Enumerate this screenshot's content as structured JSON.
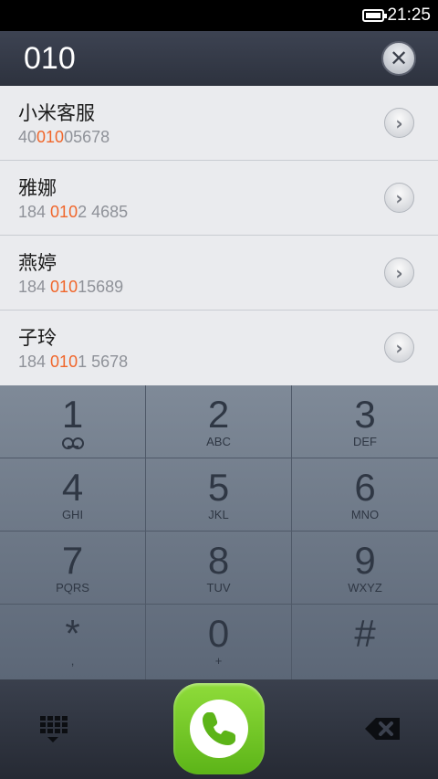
{
  "status_bar": {
    "time": "21:25"
  },
  "dialer": {
    "input": "010"
  },
  "contacts": [
    {
      "name": "小米客服",
      "num_pre": "40",
      "num_hl": "010",
      "num_post": "05678"
    },
    {
      "name": "雅娜",
      "num_pre": "184 ",
      "num_hl": "010",
      "num_post": "2 4685"
    },
    {
      "name": "燕婷",
      "num_pre": "184 ",
      "num_hl": "010",
      "num_post": "15689"
    },
    {
      "name": "子玲",
      "num_pre": "184 ",
      "num_hl": "010",
      "num_post": "1 5678"
    }
  ],
  "keys": [
    {
      "digit": "1",
      "letters": ""
    },
    {
      "digit": "2",
      "letters": "ABC"
    },
    {
      "digit": "3",
      "letters": "DEF"
    },
    {
      "digit": "4",
      "letters": "GHI"
    },
    {
      "digit": "5",
      "letters": "JKL"
    },
    {
      "digit": "6",
      "letters": "MNO"
    },
    {
      "digit": "7",
      "letters": "PQRS"
    },
    {
      "digit": "8",
      "letters": "TUV"
    },
    {
      "digit": "9",
      "letters": "WXYZ"
    },
    {
      "digit": "*",
      "letters": ","
    },
    {
      "digit": "0",
      "letters": "+"
    },
    {
      "digit": "#",
      "letters": ""
    }
  ],
  "colors": {
    "highlight": "#f0662b",
    "call_green": "#6cc623"
  },
  "icons": {
    "clear": "close-icon",
    "detail": "chevron-right-icon",
    "voicemail": "voicemail-icon",
    "keypad": "keypad-grid-icon",
    "call": "phone-handset-icon",
    "backspace": "backspace-icon"
  }
}
